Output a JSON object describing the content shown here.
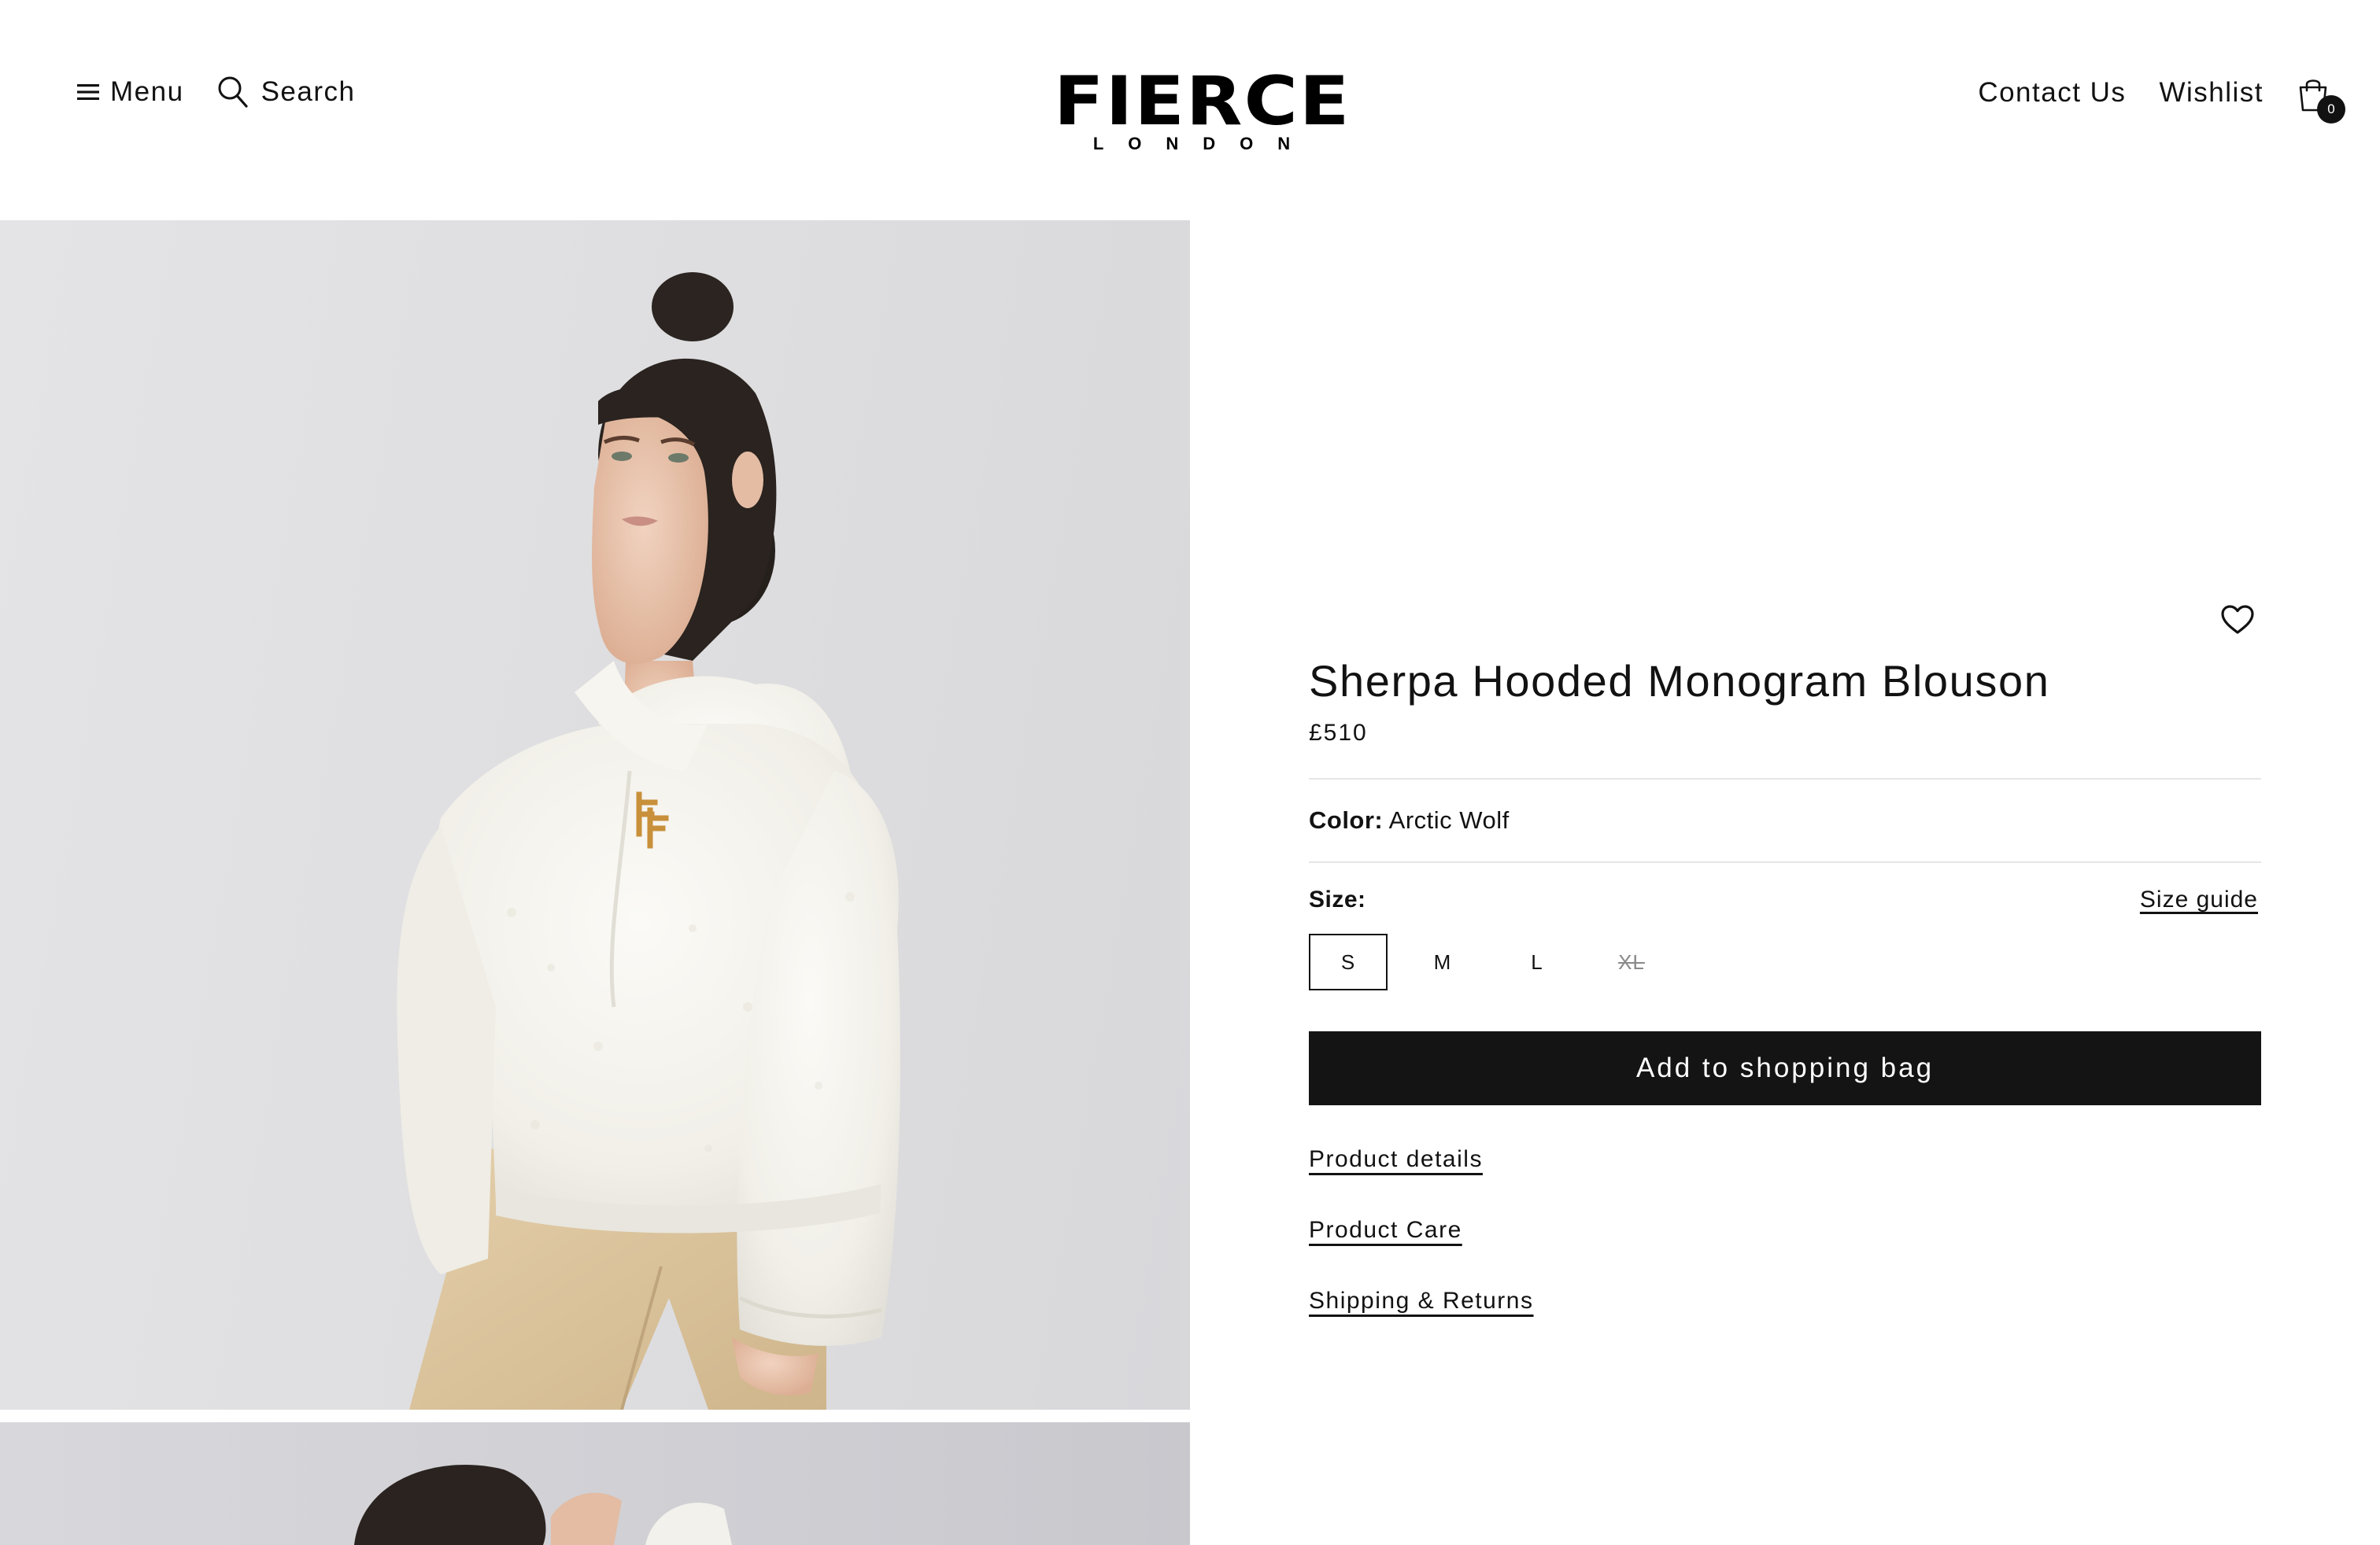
{
  "header": {
    "menu_label": "Menu",
    "search_label": "Search",
    "logo_main": "FIERCE",
    "logo_sub": "LONDON",
    "contact_label": "Contact Us",
    "wishlist_label": "Wishlist",
    "cart_count": "0",
    "icons": [
      "hamburger-icon",
      "search-icon",
      "shopping-bag-icon"
    ]
  },
  "product": {
    "title": "Sherpa Hooded Monogram Blouson",
    "price": "£510",
    "color_label": "Color:",
    "color_value": "Arctic Wolf",
    "size_label": "Size:",
    "size_guide_label": "Size guide",
    "sizes": [
      {
        "label": "S",
        "selected": true,
        "available": true
      },
      {
        "label": "M",
        "selected": false,
        "available": true
      },
      {
        "label": "L",
        "selected": false,
        "available": true
      },
      {
        "label": "XL",
        "selected": false,
        "available": false
      }
    ],
    "add_to_bag_label": "Add to shopping bag",
    "links": [
      "Product details",
      "Product Care",
      "Shipping & Returns"
    ],
    "wishlist_icon": "heart-icon"
  },
  "colors": {
    "text": "#121212",
    "button_bg": "#141414",
    "button_text": "#ffffff",
    "divider": "#e6e6e6",
    "image_bg": "#e2e2e4",
    "jacket": "#f6f4ee",
    "trousers": "#dcc6a2",
    "monogram": "#c8903a"
  }
}
